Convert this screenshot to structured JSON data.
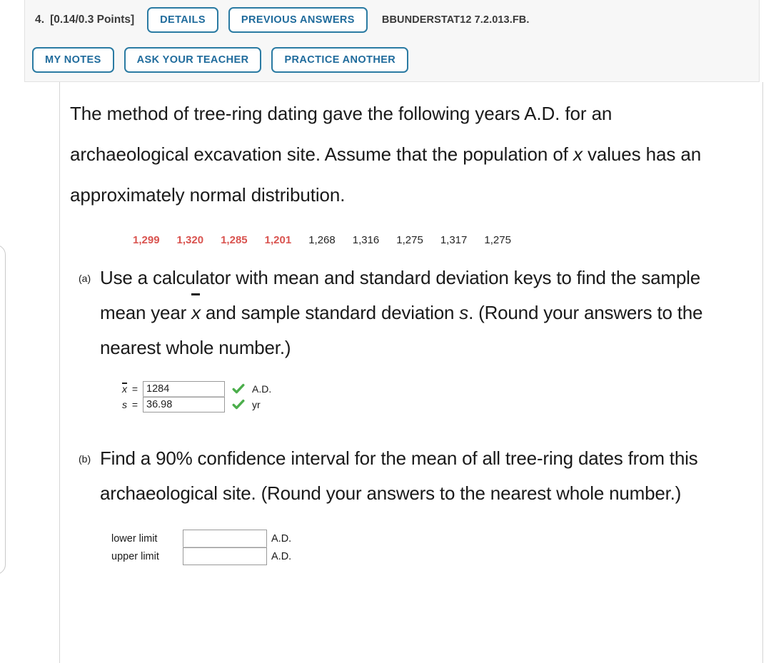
{
  "header": {
    "question_number": "4.",
    "points": "[0.14/0.3 Points]",
    "buttons_row1": [
      {
        "name": "details-button",
        "label": "DETAILS"
      },
      {
        "name": "previous-answers-button",
        "label": "PREVIOUS ANSWERS"
      }
    ],
    "question_code": "BBUNDERSTAT12 7.2.013.FB.",
    "buttons_row2": [
      {
        "name": "my-notes-button",
        "label": "MY NOTES"
      },
      {
        "name": "ask-your-teacher-button",
        "label": "ASK YOUR TEACHER"
      },
      {
        "name": "practice-another-button",
        "label": "PRACTICE ANOTHER"
      }
    ],
    "accent_border_color": "#2b7ba3",
    "accent_text_color": "#1f6b9c",
    "panel_background": "#f7f7f7"
  },
  "stem": {
    "line1": "The method of tree-ring dating gave the following years A.D.",
    "line2": "for an archaeological excavation site. Assume that the",
    "line3_pre": "population of ",
    "line3_var": "x",
    "line3_post": " values has an approximately normal",
    "line4": "distribution."
  },
  "data_values": [
    {
      "value": "1,299",
      "highlighted": true
    },
    {
      "value": "1,320",
      "highlighted": true
    },
    {
      "value": "1,285",
      "highlighted": true
    },
    {
      "value": "1,201",
      "highlighted": true
    },
    {
      "value": "1,268",
      "highlighted": false
    },
    {
      "value": "1,316",
      "highlighted": false
    },
    {
      "value": "1,275",
      "highlighted": false
    },
    {
      "value": "1,317",
      "highlighted": false
    },
    {
      "value": "1,275",
      "highlighted": false
    }
  ],
  "highlight_color": "#d9534f",
  "part_a": {
    "label": "(a)",
    "text_1": "Use a calculator with mean and standard deviation keys to find the sample mean year ",
    "xbar": "x",
    "text_2": " and sample standard deviation ",
    "s_var": "s",
    "text_3": ". (Round your answers to the nearest whole number.)",
    "answers": [
      {
        "var": "x",
        "var_has_bar": true,
        "equals": "=",
        "value": "1284",
        "placeholder": "",
        "status": "correct",
        "status_icon": "green-check-icon",
        "unit": "A.D."
      },
      {
        "var": "s",
        "var_has_bar": false,
        "equals": "=",
        "value": "36.98",
        "placeholder": "",
        "status": "correct",
        "status_icon": "green-check-icon",
        "unit": "yr"
      }
    ]
  },
  "part_b": {
    "label": "(b)",
    "text": "Find a 90% confidence interval for the mean of all tree-ring dates from this archaeological site. (Round your answers to the nearest whole number.)",
    "limits": [
      {
        "label": "lower limit",
        "value": "",
        "placeholder": "",
        "unit": "A.D."
      },
      {
        "label": "upper limit",
        "value": "",
        "placeholder": "",
        "unit": "A.D."
      }
    ]
  }
}
